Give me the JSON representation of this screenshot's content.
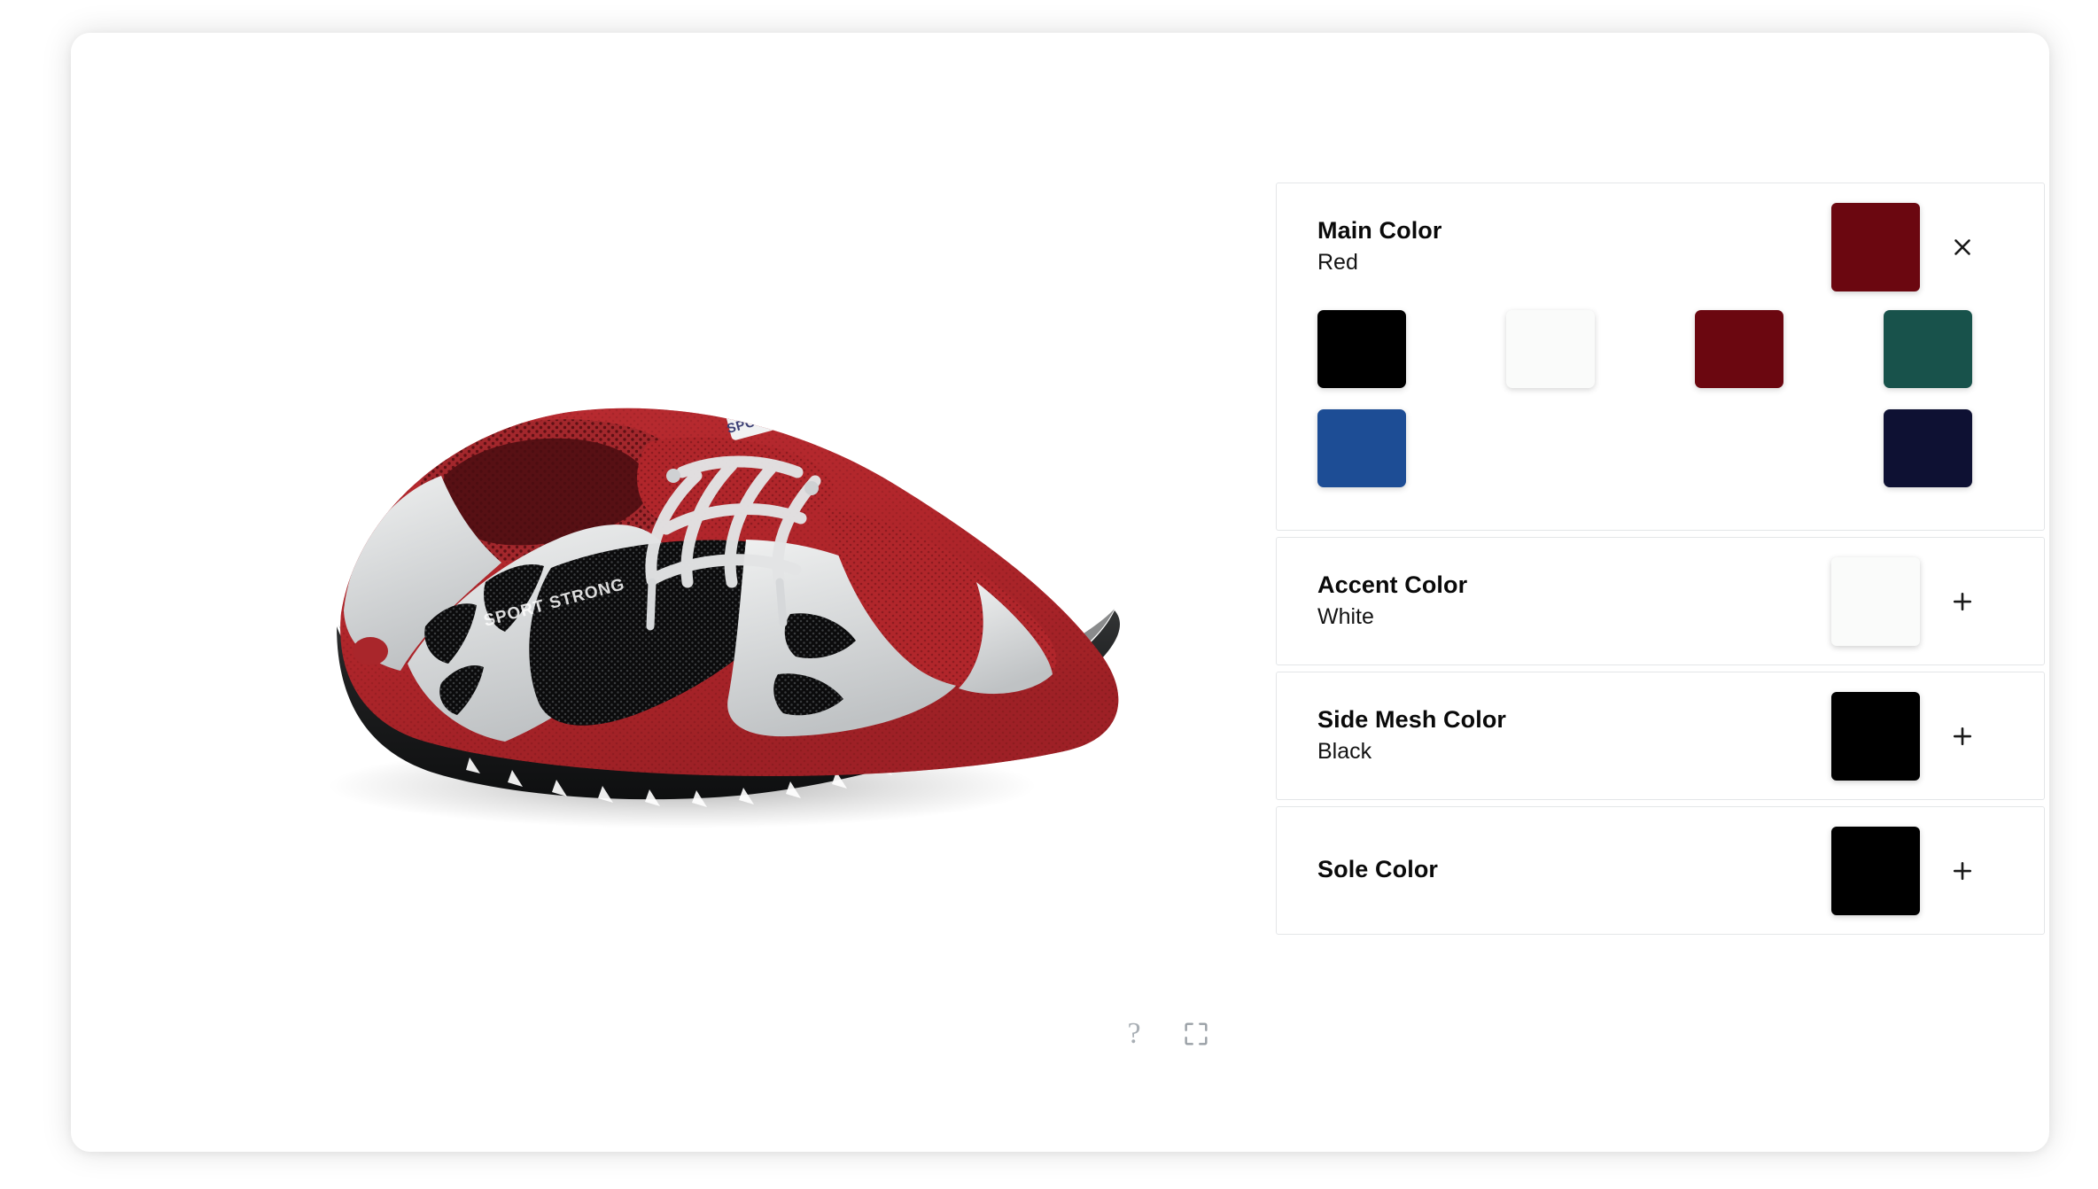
{
  "viewer": {
    "product": "athletic running shoe",
    "controls": [
      {
        "name": "help-icon",
        "glyph": "?"
      },
      {
        "name": "fullscreen-icon",
        "glyph": "expand"
      }
    ],
    "shoe_colors": {
      "main": "#b1262b",
      "main_dark": "#8a1b20",
      "accent": "#d9dadc",
      "accent_light": "#eceded",
      "side_mesh": "#141414",
      "sole": "#1b1b1b",
      "laces": "#e3e4e5",
      "collar": "#a02127"
    },
    "shoe_brand_text": "SPORTIFY",
    "shoe_side_text": "SPORT STRONG"
  },
  "panel": {
    "options": [
      {
        "id": "main-color",
        "title": "Main Color",
        "value": "Red",
        "current_hex": "#6b0710",
        "expanded": true,
        "action_icon": "close-icon",
        "swatches": [
          {
            "name": "Black",
            "hex": "#000000",
            "empty": false
          },
          {
            "name": "White",
            "hex": "#fafbfa",
            "empty": false
          },
          {
            "name": "Red",
            "hex": "#6b0710",
            "empty": false
          },
          {
            "name": "Teal",
            "hex": "#18524b",
            "empty": false
          },
          {
            "name": "Blue",
            "hex": "#1d4d95",
            "empty": false
          },
          {
            "name": "",
            "hex": "",
            "empty": true
          },
          {
            "name": "",
            "hex": "",
            "empty": true
          },
          {
            "name": "Navy",
            "hex": "#0e1133",
            "empty": false
          }
        ]
      },
      {
        "id": "accent-color",
        "title": "Accent Color",
        "value": "White",
        "current_hex": "#fafbfa",
        "expanded": false,
        "action_icon": "plus-icon",
        "swatches": []
      },
      {
        "id": "side-mesh-color",
        "title": "Side Mesh Color",
        "value": "Black",
        "current_hex": "#000000",
        "expanded": false,
        "action_icon": "plus-icon",
        "swatches": []
      },
      {
        "id": "sole-color",
        "title": "Sole Color",
        "value": "",
        "current_hex": "#000000",
        "expanded": false,
        "action_icon": "plus-icon",
        "swatches": []
      }
    ]
  },
  "theme": {
    "page_bg": "#ffffff",
    "card_bg": "#ffffff",
    "border": "#e4e6e8",
    "text_primary": "#0a0a0a",
    "text_secondary": "#141414",
    "icon_muted": "#9aa0a6"
  }
}
